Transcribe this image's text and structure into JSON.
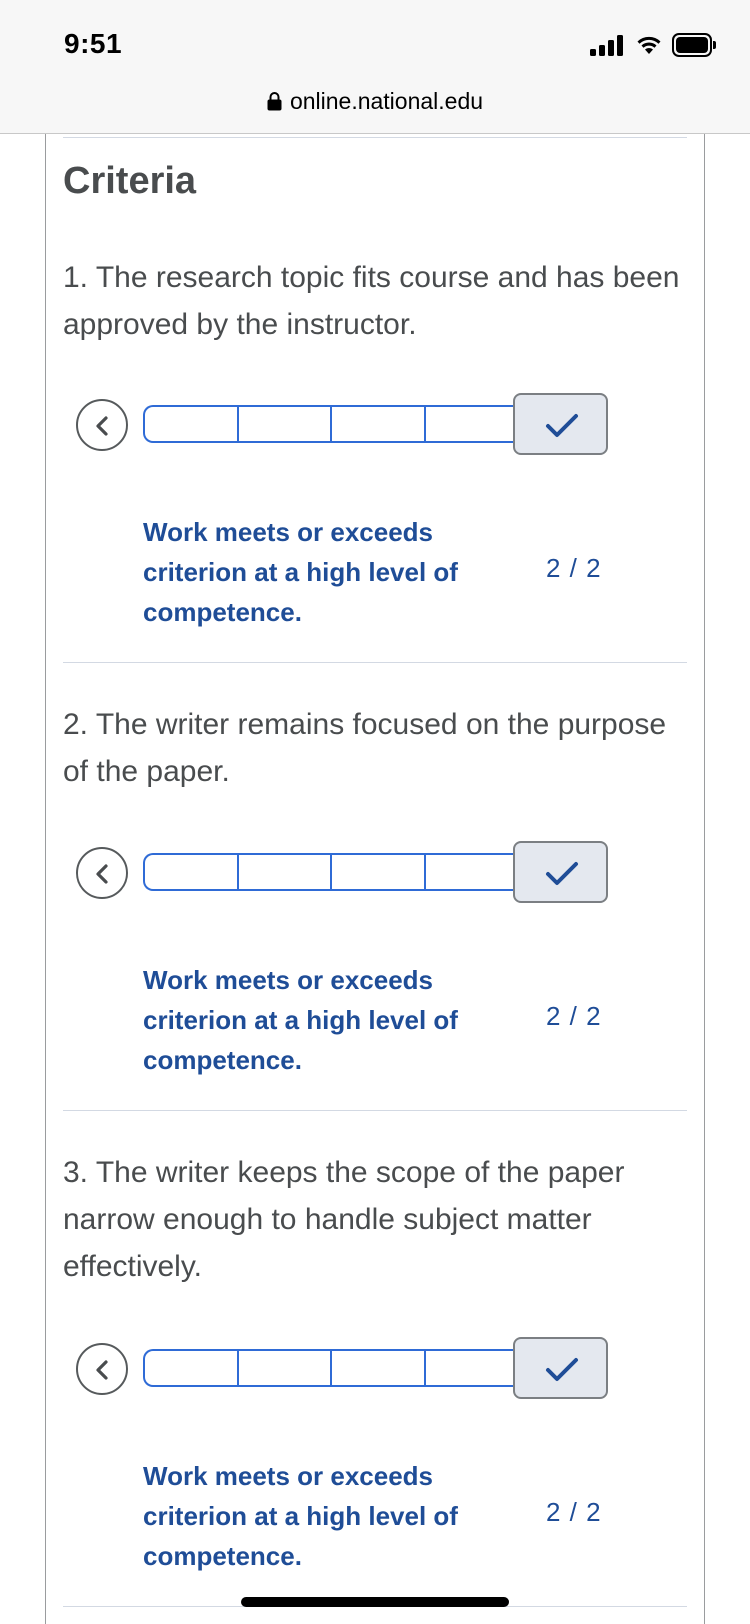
{
  "status_bar": {
    "time": "9:51"
  },
  "browser": {
    "url": "online.national.edu"
  },
  "page": {
    "heading": "Criteria"
  },
  "criteria": [
    {
      "text": "1. The research topic fits course and has been approved by the instructor.",
      "level": "Work meets or exceeds criterion at a high level of competence.",
      "score": "2 / 2"
    },
    {
      "text": "2. The writer remains focused on the purpose of the paper.",
      "level": "Work meets or exceeds criterion at a high level of competence.",
      "score": "2 / 2"
    },
    {
      "text": "3. The writer keeps the scope of the paper narrow enough to handle subject matter effectively.",
      "level": "Work meets or exceeds criterion at a high level of competence.",
      "score": "2 / 2"
    }
  ],
  "colors": {
    "accent": "#1f4d97",
    "track_border": "#2f6bd6",
    "text": "#494c4e"
  },
  "icons": [
    "lock-icon",
    "chevron-left-icon",
    "checkmark-icon",
    "signal-icon",
    "wifi-icon",
    "battery-icon"
  ]
}
